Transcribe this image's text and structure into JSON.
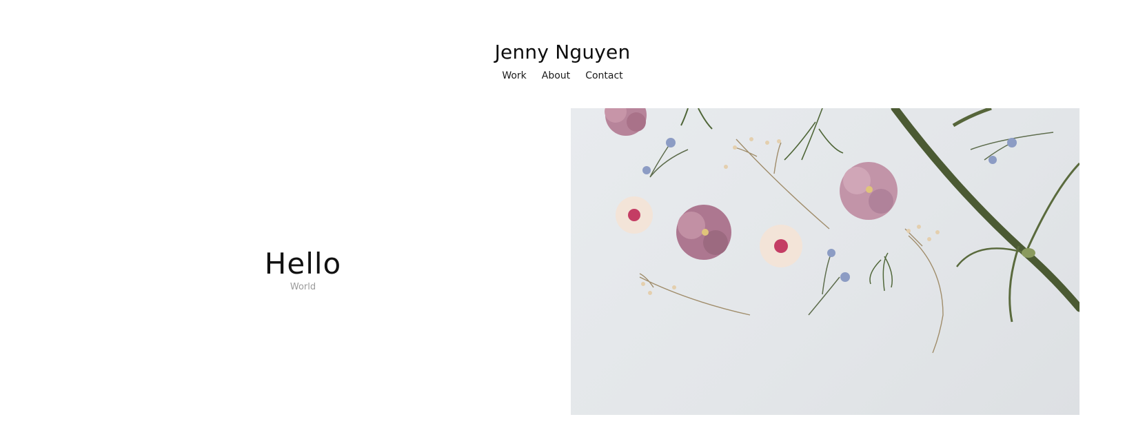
{
  "site": {
    "title": "Jenny Nguyen"
  },
  "nav": {
    "items": [
      {
        "label": "Work"
      },
      {
        "label": "About"
      },
      {
        "label": "Contact"
      }
    ]
  },
  "hero": {
    "title": "Hello",
    "subtitle": "World"
  },
  "colors": {
    "background": "#ffffff",
    "text": "#111111",
    "subtitle": "#9a9a9a",
    "photo_background": "#e4e7ea",
    "petal_pink": "#b7849a",
    "petal_cream": "#f3e4d8",
    "stem_green": "#4b5a33",
    "small_blue": "#8c9cc4"
  }
}
